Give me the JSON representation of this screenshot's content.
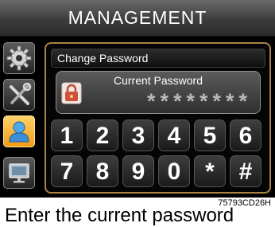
{
  "header": {
    "title": "MANAGEMENT"
  },
  "sidebar": {
    "items": [
      {
        "icon": "gear-icon"
      },
      {
        "icon": "tools-icon"
      },
      {
        "icon": "user-icon",
        "active": true
      },
      {
        "icon": "monitor-icon"
      }
    ]
  },
  "panel": {
    "title": "Change Password",
    "password_label": "Current Password",
    "password_value": "********"
  },
  "keypad": {
    "row1": [
      "1",
      "2",
      "3",
      "4",
      "5",
      "6"
    ],
    "row2": [
      "7",
      "8",
      "9",
      "0",
      "*",
      "#"
    ]
  },
  "figure_code": "75793CD26H",
  "caption": "Enter the current password",
  "colors": {
    "accent": "#f39a12",
    "panel_border": "#a98244"
  }
}
